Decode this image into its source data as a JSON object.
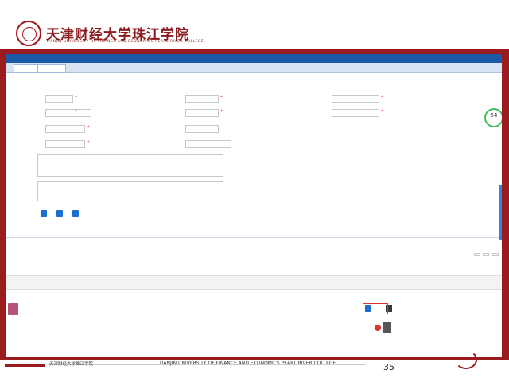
{
  "header": {
    "logo_text": "天津财经大学珠江学院",
    "logo_sub": "TIANJIN UNIVERSITY OF FINANCE AND ECONOMICS PEARL RIVER COLLEGE"
  },
  "menubar": {
    "items": [
      "",
      "",
      "",
      "",
      ""
    ]
  },
  "tabs": [
    "",
    ""
  ],
  "breadcrumb": "",
  "form": {
    "rows": [
      {
        "label": "",
        "value": ""
      },
      {
        "label": "",
        "value": ""
      },
      {
        "label": "",
        "value": ""
      },
      {
        "label": "",
        "value": ""
      }
    ],
    "textarea1": "",
    "textarea2": ""
  },
  "buttons": [
    "",
    "",
    ""
  ],
  "subtabs": [
    "",
    "",
    ""
  ],
  "toolbar": [
    "",
    "",
    ""
  ],
  "grid": {
    "headers": [
      "",
      "",
      "",
      "",
      "",
      "",
      ""
    ],
    "row": {
      "name": "",
      "size": "",
      "owner": ""
    }
  },
  "row_actions": {
    "preview": "",
    "download": ""
  },
  "tip": "",
  "progress": "54",
  "footer": {
    "cn": "天津财经大学珠江学院",
    "en": "TIANJIN UNIVERSITY OF FINANCE AND ECONOMICS PEARL RIVER COLLEGE",
    "page_number": "35"
  },
  "colors": {
    "brand_red": "#9b1b1e",
    "menu_blue": "#1a59a6",
    "highlight_red": "#e33030"
  }
}
